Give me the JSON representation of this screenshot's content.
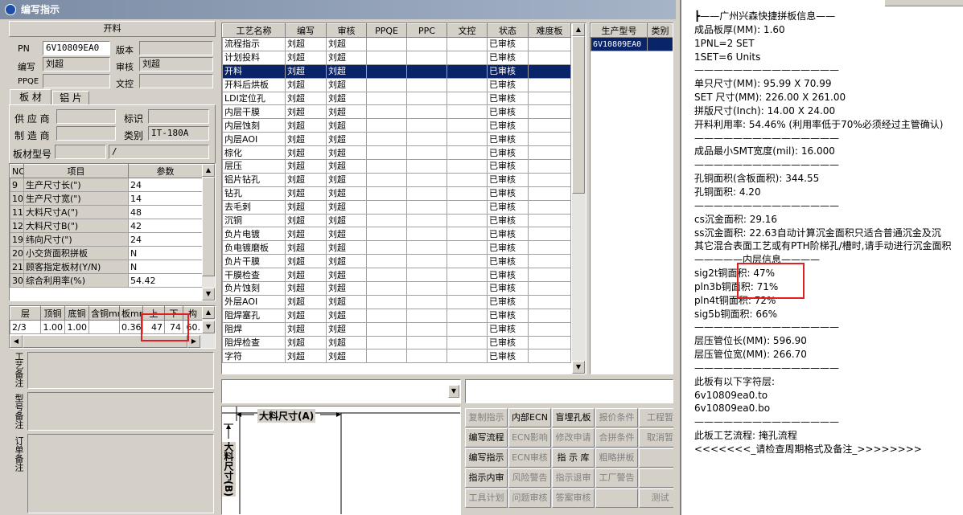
{
  "window": {
    "title": "编写指示"
  },
  "left": {
    "section_title": "开料",
    "pn_label": "PN",
    "pn_value": "6V10809EA0",
    "version_label": "版本",
    "version_value": "",
    "writer_label": "编写",
    "writer_value": "刘超",
    "reviewer_label": "审核",
    "reviewer_value": "刘超",
    "ppqe_label": "PPQE",
    "ppqe_value": "",
    "docctrl_label": "文控",
    "docctrl_value": "",
    "tabs": [
      "板 材",
      "铝 片"
    ],
    "supplier_label": "供 应 商",
    "supplier_value": "",
    "mark_label": "标识",
    "mark_value": "",
    "maker_label": "制 造 商",
    "maker_value": "",
    "category_label": "类别",
    "category_value": "IT-180A",
    "model_label": "板材型号",
    "model_value": "",
    "model_value2": "/",
    "param_headers": [
      "NO",
      "项目",
      "参数"
    ],
    "params": [
      {
        "no": "9",
        "item": "生产尺寸长(\")",
        "value": "24"
      },
      {
        "no": "10",
        "item": "生产尺寸宽(\")",
        "value": "14"
      },
      {
        "no": "11",
        "item": "大料尺寸A(\")",
        "value": "48"
      },
      {
        "no": "12",
        "item": "大料尺寸B(\")",
        "value": "42"
      },
      {
        "no": "19",
        "item": "纬向尺寸(\")",
        "value": "24"
      },
      {
        "no": "20",
        "item": "小交货面积拼板",
        "value": "N"
      },
      {
        "no": "21",
        "item": "顾客指定板材(Y/N)",
        "value": "N"
      },
      {
        "no": "30",
        "item": "综合利用率(%)",
        "value": "54.42"
      }
    ],
    "layer_headers": [
      "层",
      "顶铜",
      "底铜",
      "含铜mm",
      "板mm",
      "上",
      "下",
      "构"
    ],
    "layer_row": [
      "2/3",
      "1.00",
      "1.00",
      "0.360",
      "47",
      "74",
      "60."
    ],
    "craft_note_label": "工艺备注",
    "model_note_label": "型号备注",
    "order_note_label": "订单备注"
  },
  "process": {
    "headers": [
      "工艺名称",
      "编写",
      "审核",
      "PPQE",
      "PPC",
      "文控",
      "状态",
      "难度板"
    ],
    "rows": [
      {
        "name": "流程指示",
        "writer": "刘超",
        "reviewer": "刘超",
        "status": "已审核"
      },
      {
        "name": "计划投料",
        "writer": "刘超",
        "reviewer": "刘超",
        "status": "已审核"
      },
      {
        "name": "开料",
        "writer": "刘超",
        "reviewer": "刘超",
        "status": "已审核"
      },
      {
        "name": "开料后烘板",
        "writer": "刘超",
        "reviewer": "刘超",
        "status": "已审核"
      },
      {
        "name": "LDI定位孔",
        "writer": "刘超",
        "reviewer": "刘超",
        "status": "已审核"
      },
      {
        "name": "内层干膜",
        "writer": "刘超",
        "reviewer": "刘超",
        "status": "已审核"
      },
      {
        "name": "内层蚀刻",
        "writer": "刘超",
        "reviewer": "刘超",
        "status": "已审核"
      },
      {
        "name": "内层AOI",
        "writer": "刘超",
        "reviewer": "刘超",
        "status": "已审核"
      },
      {
        "name": "棕化",
        "writer": "刘超",
        "reviewer": "刘超",
        "status": "已审核"
      },
      {
        "name": "层压",
        "writer": "刘超",
        "reviewer": "刘超",
        "status": "已审核"
      },
      {
        "name": "铝片钻孔",
        "writer": "刘超",
        "reviewer": "刘超",
        "status": "已审核"
      },
      {
        "name": "钻孔",
        "writer": "刘超",
        "reviewer": "刘超",
        "status": "已审核"
      },
      {
        "name": "去毛刺",
        "writer": "刘超",
        "reviewer": "刘超",
        "status": "已审核"
      },
      {
        "name": "沉铜",
        "writer": "刘超",
        "reviewer": "刘超",
        "status": "已审核"
      },
      {
        "name": "负片电镀",
        "writer": "刘超",
        "reviewer": "刘超",
        "status": "已审核"
      },
      {
        "name": "负电镀磨板",
        "writer": "刘超",
        "reviewer": "刘超",
        "status": "已审核"
      },
      {
        "name": "负片干膜",
        "writer": "刘超",
        "reviewer": "刘超",
        "status": "已审核"
      },
      {
        "name": "干膜检查",
        "writer": "刘超",
        "reviewer": "刘超",
        "status": "已审核"
      },
      {
        "name": "负片蚀刻",
        "writer": "刘超",
        "reviewer": "刘超",
        "status": "已审核"
      },
      {
        "name": "外层AOI",
        "writer": "刘超",
        "reviewer": "刘超",
        "status": "已审核"
      },
      {
        "name": "阻焊塞孔",
        "writer": "刘超",
        "reviewer": "刘超",
        "status": "已审核"
      },
      {
        "name": "阻焊",
        "writer": "刘超",
        "reviewer": "刘超",
        "status": "已审核"
      },
      {
        "name": "阻焊检查",
        "writer": "刘超",
        "reviewer": "刘超",
        "status": "已审核"
      },
      {
        "name": "字符",
        "writer": "刘超",
        "reviewer": "刘超",
        "status": "已审核"
      }
    ],
    "selected_index": 2
  },
  "product": {
    "headers": [
      "生产型号",
      "类别"
    ],
    "rows": [
      {
        "model": "6V10809EA0",
        "cat": ""
      }
    ]
  },
  "diagram": {
    "a_label": "大料尺寸(A)",
    "b_label": "大料尺寸(B)"
  },
  "buttons": [
    {
      "label": "复制指示",
      "enabled": false
    },
    {
      "label": "内部ECN",
      "enabled": true
    },
    {
      "label": "盲埋孔板",
      "enabled": true
    },
    {
      "label": "报价条件",
      "enabled": false
    },
    {
      "label": "工程暂",
      "enabled": false
    },
    {
      "label": "编写流程",
      "enabled": true
    },
    {
      "label": "ECN影响",
      "enabled": false
    },
    {
      "label": "修改申请",
      "enabled": false
    },
    {
      "label": "合拼条件",
      "enabled": false
    },
    {
      "label": "取消暂",
      "enabled": false
    },
    {
      "label": "编写指示",
      "enabled": true
    },
    {
      "label": "ECN审核",
      "enabled": false
    },
    {
      "label": "指 示 库",
      "enabled": true
    },
    {
      "label": "粗略拼板",
      "enabled": false
    },
    {
      "label": "",
      "enabled": false
    },
    {
      "label": "指示内审",
      "enabled": true
    },
    {
      "label": "风险警告",
      "enabled": false
    },
    {
      "label": "指示退审",
      "enabled": false
    },
    {
      "label": "工厂警告",
      "enabled": false
    },
    {
      "label": "",
      "enabled": false
    },
    {
      "label": "工具计划",
      "enabled": false
    },
    {
      "label": "问题审核",
      "enabled": false
    },
    {
      "label": "答案审核",
      "enabled": false
    },
    {
      "label": "",
      "enabled": false
    },
    {
      "label": "测试",
      "enabled": false
    }
  ],
  "info_lines": [
    "┣——广州兴森快捷拼板信息——",
    "成品板厚(MM): 1.60",
    "1PNL=2 SET",
    "1SET=6 Units",
    "———————————————",
    "单只尺寸(MM): 95.99 X 70.99",
    "SET 尺寸(MM): 226.00 X 261.00",
    "拼版尺寸(Inch): 14.00 X 24.00",
    "开料利用率: 54.46% (利用率低于70%必须经过主管确认)",
    "———————————————",
    "成品最小SMT宽度(mil): 16.000",
    "———————————————",
    "孔铜面积(含板面积): 344.55",
    "孔铜面积: 4.20",
    "———————————————",
    "cs沉金面积: 29.16",
    "ss沉金面积: 22.63自动计算沉金面积只适合普通沉金及沉",
    "其它混合表面工艺或有PTH阶梯孔/槽时,请手动进行沉金面积",
    "—————内层信息————",
    "sig2t铜面积: 47%",
    "pln3b铜面积: 71%",
    "pln4t铜面积: 72%",
    "sig5b铜面积: 66%",
    "———————————————",
    "层压管位长(MM): 596.90",
    "层压管位宽(MM): 266.70",
    "———————————————",
    "此板有以下字符层:",
    "6v10809ea0.to",
    "6v10809ea0.bo",
    "———————————————",
    "此板工艺流程: 掩孔流程",
    "<<<<<<<_请检查周期格式及备注_>>>>>>>>"
  ]
}
